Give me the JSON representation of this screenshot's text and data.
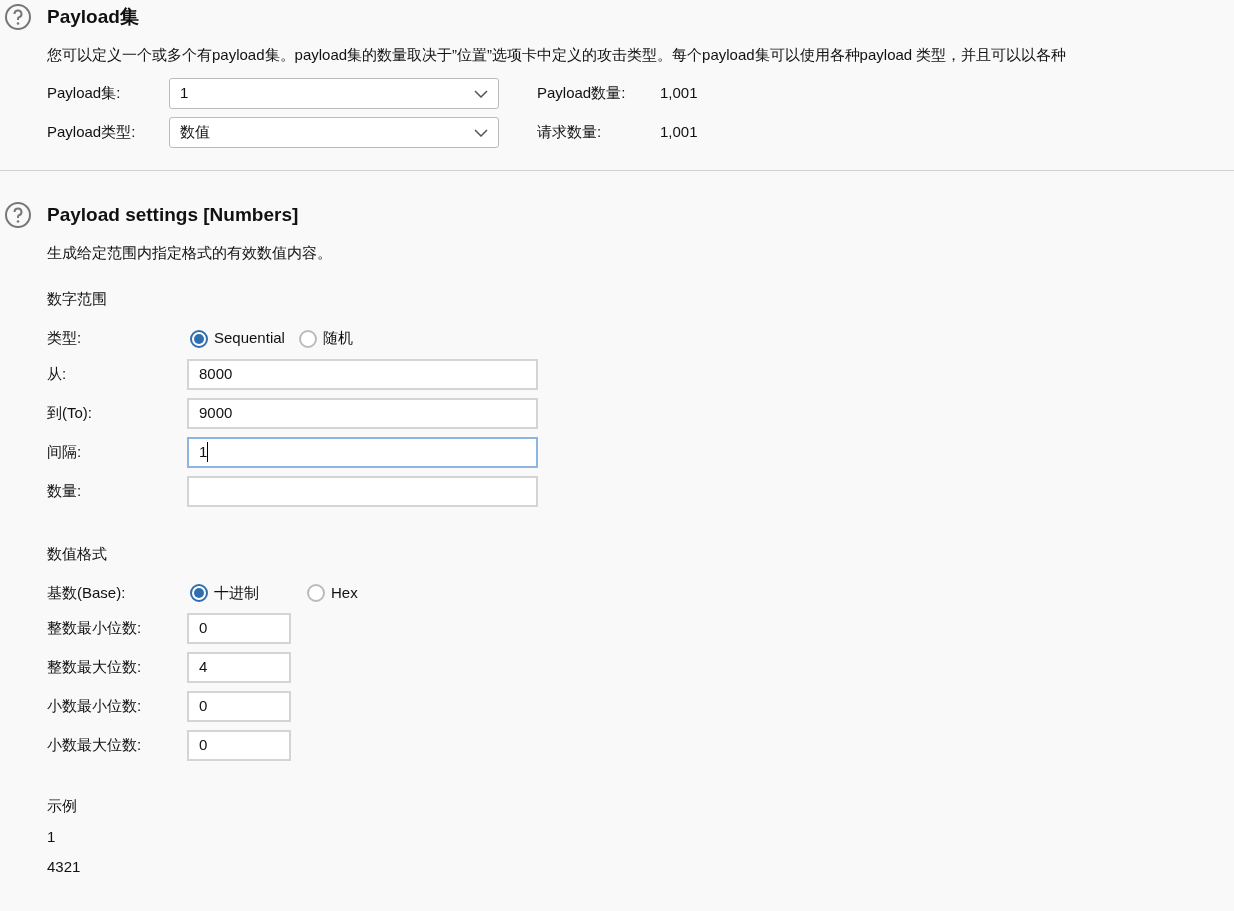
{
  "payload_sets": {
    "title": "Payload集",
    "description": "您可以定义一个或多个有payload集。payload集的数量取决于”位置”选项卡中定义的攻击类型。每个payload集可以使用各种payload 类型，并且可以以各种",
    "selects": [
      {
        "label": "Payload集:",
        "value": "1",
        "stat_label": "Payload数量:",
        "stat_value": "1,001"
      },
      {
        "label": "Payload类型:",
        "value": "数值",
        "stat_label": "请求数量:",
        "stat_value": "1,001"
      }
    ]
  },
  "payload_settings": {
    "title": "Payload settings [Numbers]",
    "description": "生成给定范围内指定格式的有效数值内容。",
    "range": {
      "heading": "数字范围",
      "type_label": "类型:",
      "options": [
        {
          "label": "Sequential",
          "selected": true
        },
        {
          "label": "随机",
          "selected": false
        }
      ],
      "fields": [
        {
          "label": "从:",
          "value": "8000",
          "focused": false
        },
        {
          "label": "到(To):",
          "value": "9000",
          "focused": false
        },
        {
          "label": "间隔:",
          "value": "1",
          "focused": true
        },
        {
          "label": "数量:",
          "focused": false
        }
      ]
    },
    "format": {
      "heading": "数值格式",
      "base_label": "基数(Base):",
      "options": [
        {
          "label": "十进制",
          "selected": true
        },
        {
          "label": "Hex",
          "selected": false
        }
      ],
      "fields": [
        {
          "label": "整数最小位数:",
          "value": "0",
          "focused": false
        },
        {
          "label": "整数最大位数:",
          "value": "4",
          "focused": false
        },
        {
          "label": "小数最小位数:",
          "value": "0",
          "focused": false
        },
        {
          "label": "小数最大位数:",
          "value": "0",
          "focused": false
        }
      ]
    },
    "examples": {
      "heading": "示例",
      "values": [
        "1",
        "4321"
      ]
    }
  }
}
